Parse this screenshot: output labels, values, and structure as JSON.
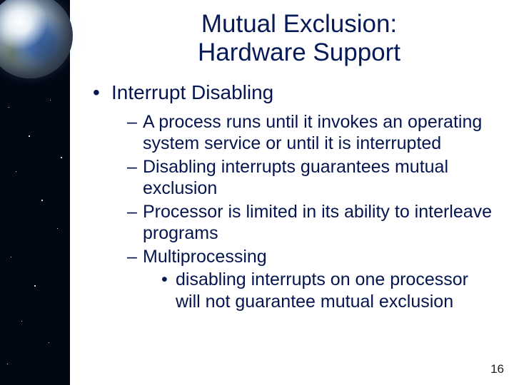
{
  "title_line1": "Mutual Exclusion:",
  "title_line2": "Hardware Support",
  "bullets": {
    "lvl1_0": "Interrupt Disabling",
    "lvl2_0": "A process runs until it invokes an operating system service or until it is interrupted",
    "lvl2_1": "Disabling interrupts guarantees mutual exclusion",
    "lvl2_2": "Processor is limited in its ability to interleave programs",
    "lvl2_3": "Multiprocessing",
    "lvl3_0": "disabling interrupts on one processor will not guarantee mutual exclusion"
  },
  "page_number": "16"
}
